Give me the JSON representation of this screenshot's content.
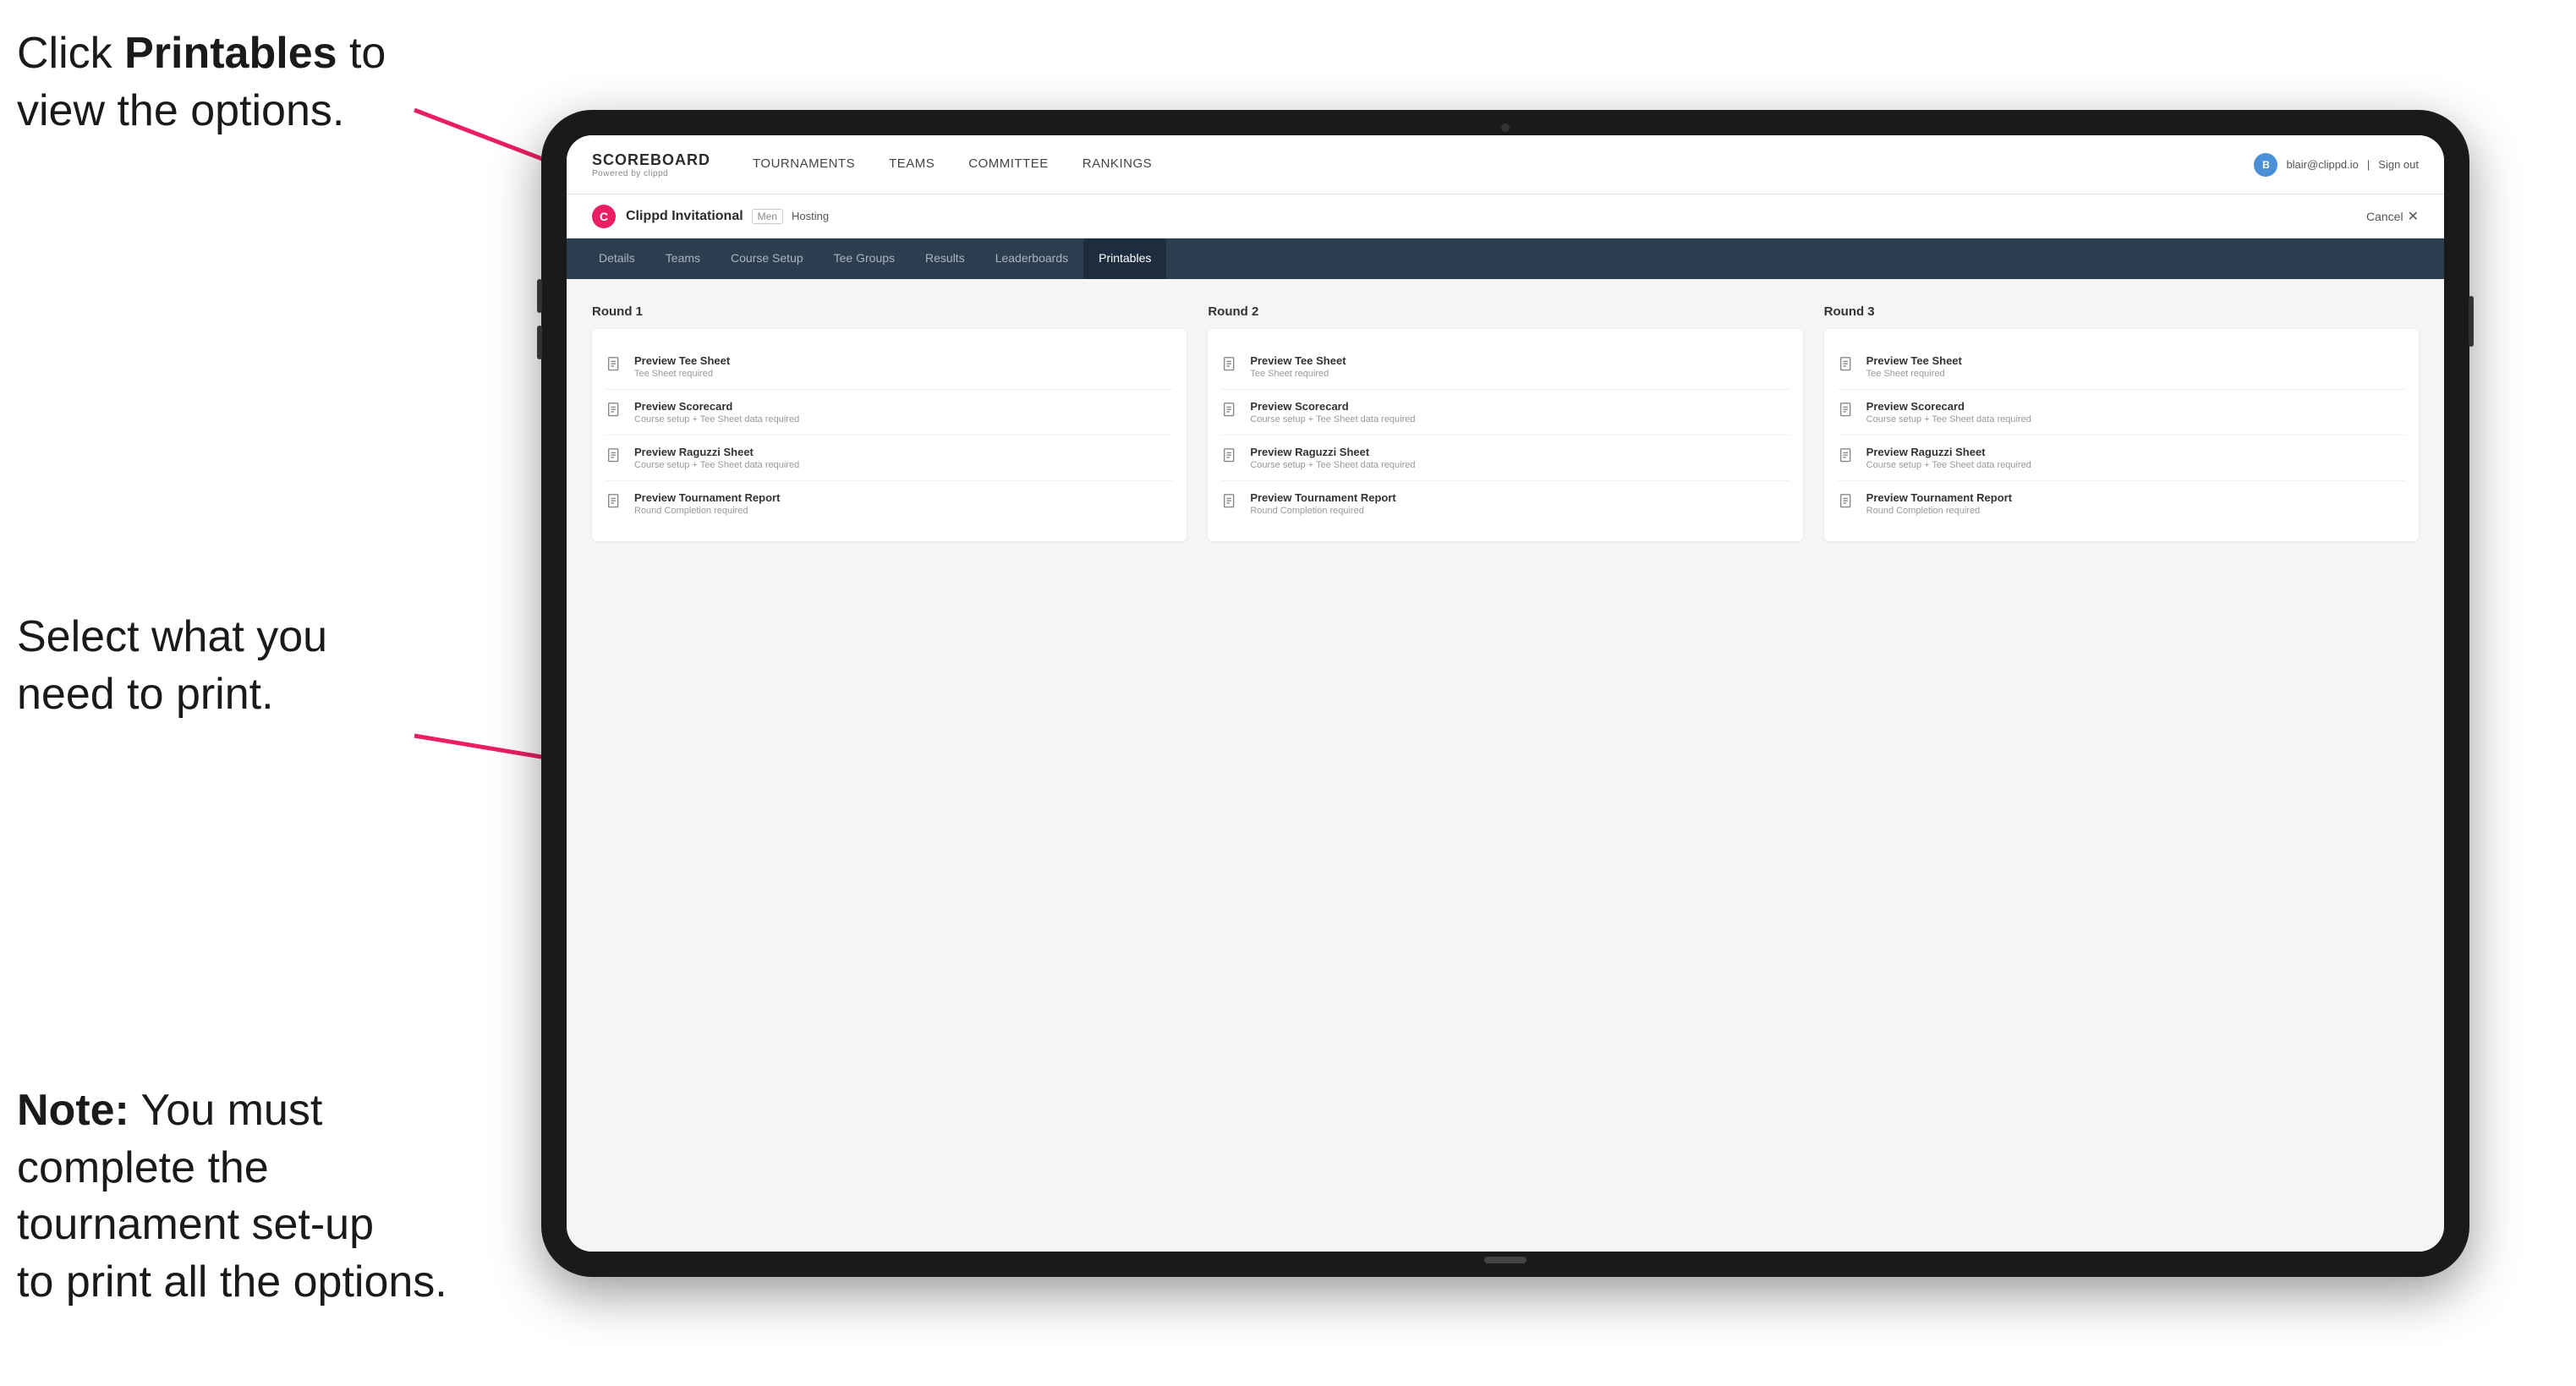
{
  "annotations": {
    "top": {
      "line1": "Click ",
      "bold": "Printables",
      "line2": " to",
      "line3": "view the options."
    },
    "middle": {
      "text": "Select what you need to print."
    },
    "bottom": {
      "note_bold": "Note:",
      "note_text": " You must complete the tournament set-up to print all the options."
    }
  },
  "nav": {
    "brand_title": "SCOREBOARD",
    "brand_sub": "Powered by clippd",
    "links": [
      "TOURNAMENTS",
      "TEAMS",
      "COMMITTEE",
      "RANKINGS"
    ],
    "user_email": "blair@clippd.io",
    "sign_out": "Sign out"
  },
  "tournament": {
    "name": "Clippd Invitational",
    "tag": "Men",
    "hosting": "Hosting",
    "cancel": "Cancel"
  },
  "tabs": [
    {
      "label": "Details",
      "active": false
    },
    {
      "label": "Teams",
      "active": false
    },
    {
      "label": "Course Setup",
      "active": false
    },
    {
      "label": "Tee Groups",
      "active": false
    },
    {
      "label": "Results",
      "active": false
    },
    {
      "label": "Leaderboards",
      "active": false
    },
    {
      "label": "Printables",
      "active": true
    }
  ],
  "rounds": [
    {
      "title": "Round 1",
      "items": [
        {
          "label": "Preview Tee Sheet",
          "sublabel": "Tee Sheet required"
        },
        {
          "label": "Preview Scorecard",
          "sublabel": "Course setup + Tee Sheet data required"
        },
        {
          "label": "Preview Raguzzi Sheet",
          "sublabel": "Course setup + Tee Sheet data required"
        },
        {
          "label": "Preview Tournament Report",
          "sublabel": "Round Completion required"
        }
      ]
    },
    {
      "title": "Round 2",
      "items": [
        {
          "label": "Preview Tee Sheet",
          "sublabel": "Tee Sheet required"
        },
        {
          "label": "Preview Scorecard",
          "sublabel": "Course setup + Tee Sheet data required"
        },
        {
          "label": "Preview Raguzzi Sheet",
          "sublabel": "Course setup + Tee Sheet data required"
        },
        {
          "label": "Preview Tournament Report",
          "sublabel": "Round Completion required"
        }
      ]
    },
    {
      "title": "Round 3",
      "items": [
        {
          "label": "Preview Tee Sheet",
          "sublabel": "Tee Sheet required"
        },
        {
          "label": "Preview Scorecard",
          "sublabel": "Course setup + Tee Sheet data required"
        },
        {
          "label": "Preview Raguzzi Sheet",
          "sublabel": "Course setup + Tee Sheet data required"
        },
        {
          "label": "Preview Tournament Report",
          "sublabel": "Round Completion required"
        }
      ]
    }
  ],
  "colors": {
    "arrow": "#e91e63",
    "accent": "#e91e63"
  }
}
